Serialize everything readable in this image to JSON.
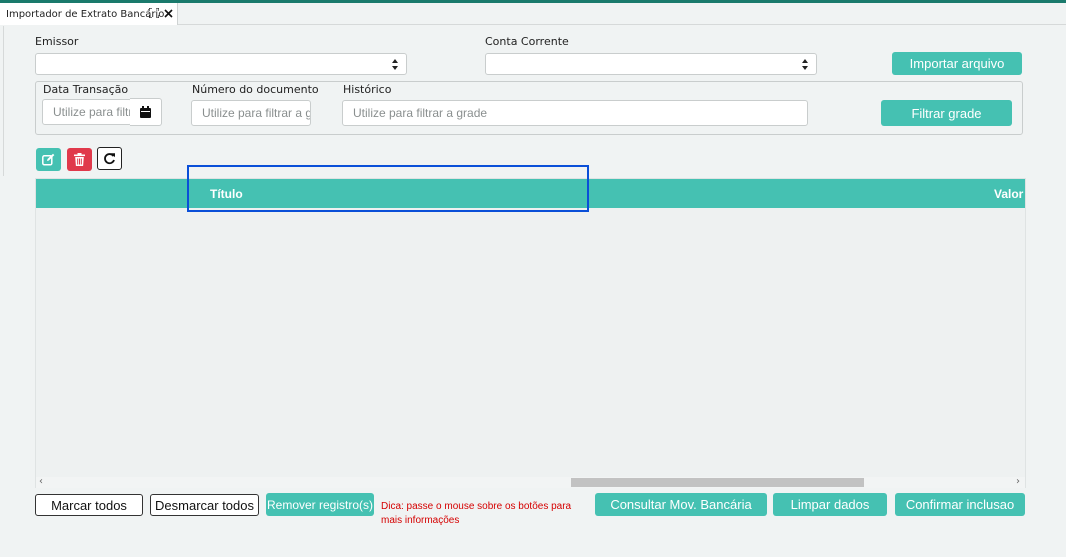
{
  "tab": {
    "title": "Importador de Extrato Bancário",
    "expand_icon": "expand-icon",
    "close_icon": "close-icon"
  },
  "form": {
    "emissor_label": "Emissor",
    "emissor_value": "",
    "conta_label": "Conta Corrente",
    "conta_value": "",
    "import_button": "Importar arquivo"
  },
  "filters": {
    "data_label": "Data Transação",
    "data_placeholder": "Utilize para filtrar a grade",
    "numero_label": "Número do documento",
    "numero_placeholder": "Utilize para filtrar a grade",
    "historico_label": "Histórico",
    "historico_placeholder": "Utilize para filtrar a grade",
    "filter_button": "Filtrar grade"
  },
  "toolbar": {
    "edit_icon": "edit-icon",
    "delete_icon": "trash-icon",
    "refresh_icon": "refresh-icon"
  },
  "grid": {
    "columns": [
      "Título",
      "Valor"
    ],
    "rows": []
  },
  "footer": {
    "mark_all": "Marcar todos",
    "unmark_all": "Desmarcar todos",
    "remove": "Remover registro(s)",
    "tip": "Dica: passe o mouse sobre os botões para mais informações",
    "consult": "Consultar Mov. Bancária",
    "clear": "Limpar dados",
    "confirm": "Confirmar inclusao"
  },
  "colors": {
    "accent": "#45c1b2",
    "danger": "#e0394b",
    "tip": "#d50000",
    "highlight": "#0a4fd8"
  }
}
